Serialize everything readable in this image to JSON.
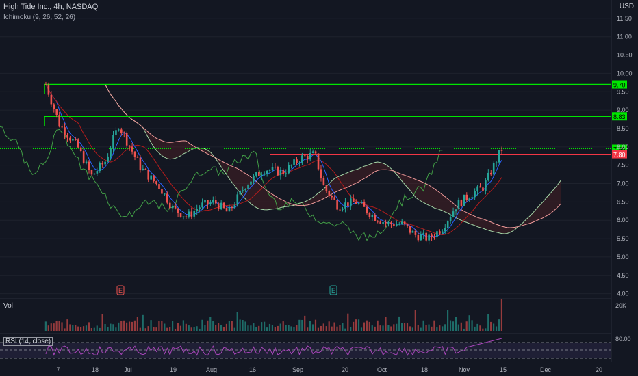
{
  "header": {
    "symbol": "High Tide Inc., 4h, NASDAQ",
    "indicator": "Ichimoku (9, 26, 52, 26)",
    "currency": "USD"
  },
  "volume_pane": {
    "label": "Vol",
    "axis_label": "20K"
  },
  "rsi_pane": {
    "label": "RSI (14, close)",
    "axis_label": "80.00"
  },
  "price_axis": {
    "ticks": [
      "4.00",
      "4.50",
      "5.00",
      "5.50",
      "6.00",
      "6.50",
      "7.00",
      "7.50",
      "8.00",
      "8.50",
      "9.00",
      "9.50",
      "10.00",
      "10.50",
      "11.00",
      "11.50"
    ]
  },
  "time_axis": {
    "labels": [
      "7",
      "18",
      "Jul",
      "19",
      "Aug",
      "16",
      "Sep",
      "20",
      "Oct",
      "18",
      "Nov",
      "15",
      "Dec",
      "20"
    ]
  },
  "events": [
    {
      "label": "E",
      "color": "#ef5350"
    },
    {
      "label": "E",
      "color": "#26a69a"
    }
  ],
  "chart_data": {
    "type": "candlestick",
    "ylim": [
      3.9,
      12.0
    ],
    "resistance_levels": [
      {
        "price": 9.7,
        "label": "9.70",
        "color": "#00e600"
      },
      {
        "price": 8.83,
        "label": "8.83",
        "color": "#00e600"
      }
    ],
    "last_price": {
      "price": 7.95,
      "label": "7.95",
      "color": "#00e600"
    },
    "other_level": {
      "price": 7.8,
      "label": "7.80",
      "color": "#f23645"
    },
    "price_path": [
      [
        0.0,
        9.7
      ],
      [
        0.03,
        8.6
      ],
      [
        0.07,
        8.0
      ],
      [
        0.1,
        7.2
      ],
      [
        0.13,
        7.6
      ],
      [
        0.16,
        8.6
      ],
      [
        0.18,
        8.1
      ],
      [
        0.21,
        7.4
      ],
      [
        0.25,
        6.9
      ],
      [
        0.28,
        6.3
      ],
      [
        0.31,
        6.1
      ],
      [
        0.34,
        6.4
      ],
      [
        0.37,
        6.5
      ],
      [
        0.4,
        6.2
      ],
      [
        0.44,
        7.0
      ],
      [
        0.48,
        7.4
      ],
      [
        0.52,
        7.3
      ],
      [
        0.56,
        7.7
      ],
      [
        0.59,
        7.8
      ],
      [
        0.61,
        6.9
      ],
      [
        0.64,
        6.4
      ],
      [
        0.68,
        6.5
      ],
      [
        0.72,
        6.1
      ],
      [
        0.75,
        5.9
      ],
      [
        0.78,
        5.9
      ],
      [
        0.81,
        5.6
      ],
      [
        0.84,
        5.5
      ],
      [
        0.87,
        5.8
      ],
      [
        0.9,
        6.4
      ],
      [
        0.93,
        6.7
      ],
      [
        0.96,
        6.9
      ],
      [
        1.0,
        7.95
      ]
    ]
  }
}
